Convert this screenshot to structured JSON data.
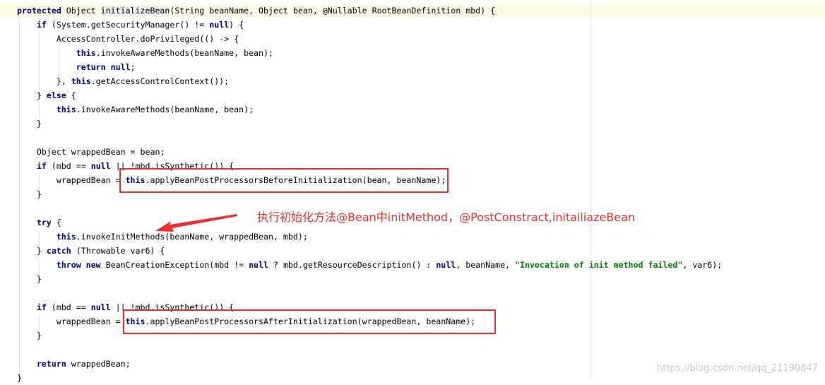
{
  "colors": {
    "keyword": "#000080",
    "string": "#008000",
    "annotation": "#e8312f",
    "current_line": "#fdfbe6"
  },
  "code_lines": [
    [
      {
        "t": "protected",
        "c": "kw"
      },
      {
        "t": " Object "
      },
      {
        "t": "initializeBean",
        "c": "hl"
      },
      {
        "t": "(String beanName, Object bean, @Nullable RootBeanDefinition mbd) {"
      }
    ],
    [
      {
        "t": "    "
      },
      {
        "t": "if",
        "c": "kw"
      },
      {
        "t": " (System.getSecurityManager() != "
      },
      {
        "t": "null",
        "c": "kw"
      },
      {
        "t": ") {"
      }
    ],
    [
      {
        "t": "        AccessController.doPrivileged(() -> {"
      }
    ],
    [
      {
        "t": "            "
      },
      {
        "t": "this",
        "c": "kw"
      },
      {
        "t": ".invokeAwareMethods(beanName, bean);"
      }
    ],
    [
      {
        "t": "            "
      },
      {
        "t": "return null",
        "c": "kw"
      },
      {
        "t": ";"
      }
    ],
    [
      {
        "t": "        }, "
      },
      {
        "t": "this",
        "c": "kw"
      },
      {
        "t": ".getAccessControlContext());"
      }
    ],
    [
      {
        "t": "    } "
      },
      {
        "t": "else",
        "c": "kw"
      },
      {
        "t": " {"
      }
    ],
    [
      {
        "t": "        "
      },
      {
        "t": "this",
        "c": "kw"
      },
      {
        "t": ".invokeAwareMethods(beanName, bean);"
      }
    ],
    [
      {
        "t": "    }"
      }
    ],
    [
      {
        "t": ""
      }
    ],
    [
      {
        "t": "    Object wrappedBean = bean;"
      }
    ],
    [
      {
        "t": "    "
      },
      {
        "t": "if",
        "c": "kw"
      },
      {
        "t": " (mbd == "
      },
      {
        "t": "null",
        "c": "kw"
      },
      {
        "t": " || !mbd.isSynthetic()) {"
      }
    ],
    [
      {
        "t": "        wrappedBean = "
      },
      {
        "t": "this",
        "c": "kw"
      },
      {
        "t": ".applyBeanPostProcessorsBeforeInitialization(bean, beanName);"
      }
    ],
    [
      {
        "t": "    }"
      }
    ],
    [
      {
        "t": ""
      }
    ],
    [
      {
        "t": "    "
      },
      {
        "t": "try",
        "c": "kw"
      },
      {
        "t": " {"
      }
    ],
    [
      {
        "t": "        "
      },
      {
        "t": "this",
        "c": "kw"
      },
      {
        "t": ".invokeInitMethods(beanName, wrappedBean, mbd);"
      }
    ],
    [
      {
        "t": "    } "
      },
      {
        "t": "catch",
        "c": "kw"
      },
      {
        "t": " (Throwable var6) {"
      }
    ],
    [
      {
        "t": "        "
      },
      {
        "t": "throw new",
        "c": "kw"
      },
      {
        "t": " BeanCreationException(mbd != "
      },
      {
        "t": "null",
        "c": "kw"
      },
      {
        "t": " ? mbd.getResourceDescription() : "
      },
      {
        "t": "null",
        "c": "kw"
      },
      {
        "t": ", beanName, "
      },
      {
        "t": "\"Invocation of init method failed\"",
        "c": "str"
      },
      {
        "t": ", var6);"
      }
    ],
    [
      {
        "t": "    }"
      }
    ],
    [
      {
        "t": ""
      }
    ],
    [
      {
        "t": "    "
      },
      {
        "t": "if",
        "c": "kw"
      },
      {
        "t": " (mbd == "
      },
      {
        "t": "null",
        "c": "kw"
      },
      {
        "t": " || !mbd.isSynthetic()) {"
      }
    ],
    [
      {
        "t": "        wrappedBean = "
      },
      {
        "t": "this",
        "c": "kw"
      },
      {
        "t": ".applyBeanPostProcessorsAfterInitialization(wrappedBean, beanName);"
      }
    ],
    [
      {
        "t": "    }"
      }
    ],
    [
      {
        "t": ""
      }
    ],
    [
      {
        "t": "    "
      },
      {
        "t": "return",
        "c": "kw"
      },
      {
        "t": " wrappedBean;"
      }
    ],
    [
      {
        "t": "}"
      }
    ]
  ],
  "annotation": {
    "text": "执行初始化方法@Bean中initMethod，@PostConstract,initailiazeBean"
  },
  "watermark": {
    "text": "https://blog.csdn.net/qq_21190847"
  }
}
